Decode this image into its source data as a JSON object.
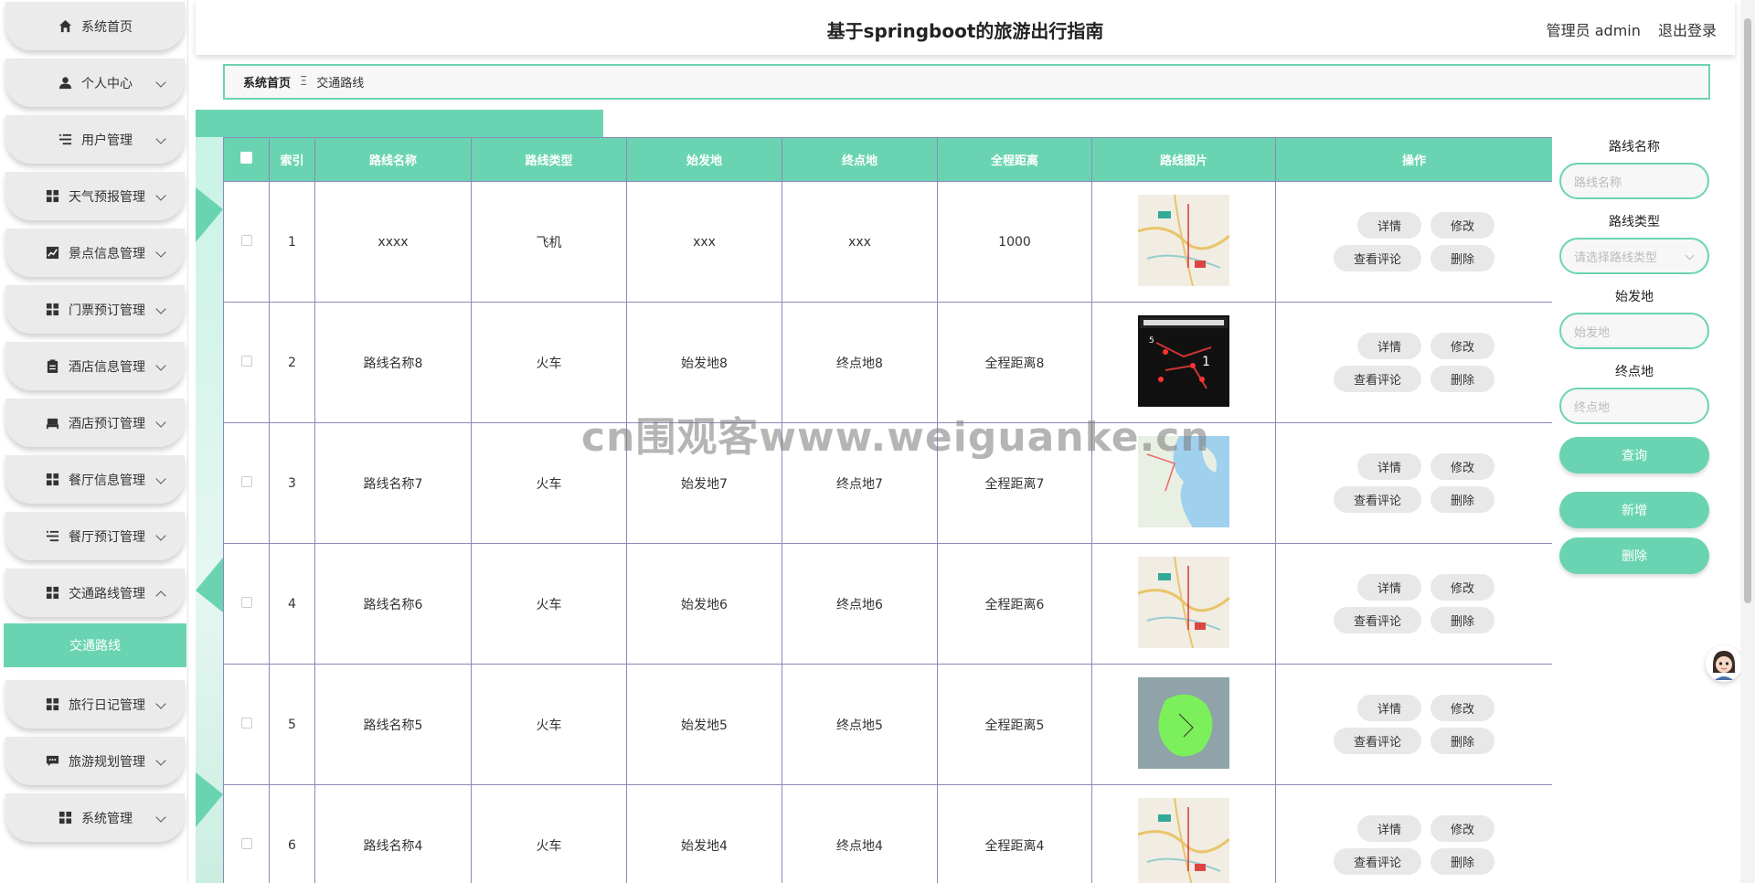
{
  "header": {
    "title": "基于springboot的旅游出行指南",
    "user": "管理员 admin",
    "logout": "退出登录"
  },
  "sidebar": {
    "items": [
      {
        "label": "系统首页",
        "icon": "home-icon",
        "expandable": false
      },
      {
        "label": "个人中心",
        "icon": "user-icon",
        "expandable": true
      },
      {
        "label": "用户管理",
        "icon": "list-icon",
        "expandable": true
      },
      {
        "label": "天气预报管理",
        "icon": "grid-icon",
        "expandable": true
      },
      {
        "label": "景点信息管理",
        "icon": "chart-icon",
        "expandable": true
      },
      {
        "label": "门票预订管理",
        "icon": "grid-icon",
        "expandable": true
      },
      {
        "label": "酒店信息管理",
        "icon": "clipboard-icon",
        "expandable": true
      },
      {
        "label": "酒店预订管理",
        "icon": "bed-icon",
        "expandable": true
      },
      {
        "label": "餐厅信息管理",
        "icon": "grid-icon",
        "expandable": true
      },
      {
        "label": "餐厅预订管理",
        "icon": "list-icon",
        "expandable": true
      },
      {
        "label": "交通路线管理",
        "icon": "grid-icon",
        "expandable": true,
        "open": true
      },
      {
        "label": "旅行日记管理",
        "icon": "grid-icon",
        "expandable": true
      },
      {
        "label": "旅游规划管理",
        "icon": "chat-icon",
        "expandable": true
      },
      {
        "label": "系统管理",
        "icon": "grid-icon",
        "expandable": true
      }
    ],
    "active_sub": "交通路线"
  },
  "breadcrumb": {
    "home": "系统首页",
    "sep": "Ξ",
    "current": "交通路线"
  },
  "table": {
    "columns": [
      "",
      "索引",
      "路线名称",
      "路线类型",
      "始发地",
      "终点地",
      "全程距离",
      "路线图片",
      "操作"
    ],
    "rows": [
      {
        "index": "1",
        "name": "xxxx",
        "type": "飞机",
        "from": "xxx",
        "to": "xxx",
        "distance": "1000",
        "img": "map-light"
      },
      {
        "index": "2",
        "name": "路线名称8",
        "type": "火车",
        "from": "始发地8",
        "to": "终点地8",
        "distance": "全程距离8",
        "img": "map-dark"
      },
      {
        "index": "3",
        "name": "路线名称7",
        "type": "火车",
        "from": "始发地7",
        "to": "终点地7",
        "distance": "全程距离7",
        "img": "map-blue"
      },
      {
        "index": "4",
        "name": "路线名称6",
        "type": "火车",
        "from": "始发地6",
        "to": "终点地6",
        "distance": "全程距离6",
        "img": "map-light"
      },
      {
        "index": "5",
        "name": "路线名称5",
        "type": "火车",
        "from": "始发地5",
        "to": "终点地5",
        "distance": "全程距离5",
        "img": "map-green"
      },
      {
        "index": "6",
        "name": "路线名称4",
        "type": "火车",
        "from": "始发地4",
        "to": "终点地4",
        "distance": "全程距离4",
        "img": "map-light"
      }
    ],
    "actions": {
      "detail": "详情",
      "edit": "修改",
      "reviews": "查看评论",
      "delete": "删除"
    }
  },
  "search": {
    "name_label": "路线名称",
    "name_placeholder": "路线名称",
    "type_label": "路线类型",
    "type_placeholder": "请选择路线类型",
    "from_label": "始发地",
    "from_placeholder": "始发地",
    "to_label": "终点地",
    "to_placeholder": "终点地",
    "query": "查询",
    "add": "新增",
    "delete": "删除"
  },
  "watermark": "cn围观客www.weiguanke.cn",
  "colors": {
    "accent": "#6ad4b2",
    "border": "#8a8ab8"
  }
}
